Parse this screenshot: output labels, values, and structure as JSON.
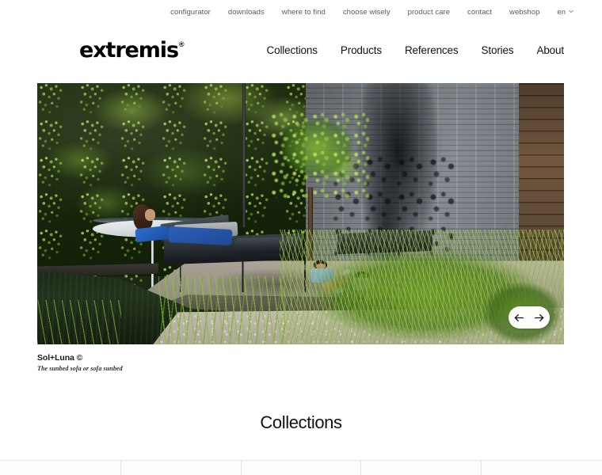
{
  "site": {
    "brand": "extremis",
    "brand_mark": "®"
  },
  "utility_nav": {
    "items": [
      {
        "label": "configurator"
      },
      {
        "label": "downloads"
      },
      {
        "label": "where to find"
      },
      {
        "label": "choose wisely"
      },
      {
        "label": "product care"
      },
      {
        "label": "contact"
      },
      {
        "label": "webshop"
      }
    ],
    "language": {
      "label": "en",
      "icon": "chevron-down-icon"
    }
  },
  "main_nav": {
    "items": [
      {
        "label": "Collections"
      },
      {
        "label": "Products"
      },
      {
        "label": "References"
      },
      {
        "label": "Stories"
      },
      {
        "label": "About"
      }
    ]
  },
  "hero": {
    "alt": "People relaxing on Sol+Luna sunbeds on a stone terrace beside a garden pond",
    "carousel": {
      "prev_icon": "arrow-left-icon",
      "prev_label": "Previous slide",
      "next_icon": "arrow-right-icon",
      "next_label": "Next slide"
    },
    "caption": {
      "title": "Sol+Luna ©",
      "subtitle": "The sunbed sofa or sofa sunbed"
    }
  },
  "collections": {
    "heading": "Collections",
    "tiles": [
      {
        "id": "tile-1"
      },
      {
        "id": "tile-2"
      },
      {
        "id": "tile-3"
      },
      {
        "id": "tile-4"
      },
      {
        "id": "tile-5"
      }
    ]
  },
  "colors": {
    "text_primary": "#111111",
    "text_muted": "#5c5c5c",
    "page_bg": "#ffffff",
    "grid_border": "#e6e6e6"
  }
}
